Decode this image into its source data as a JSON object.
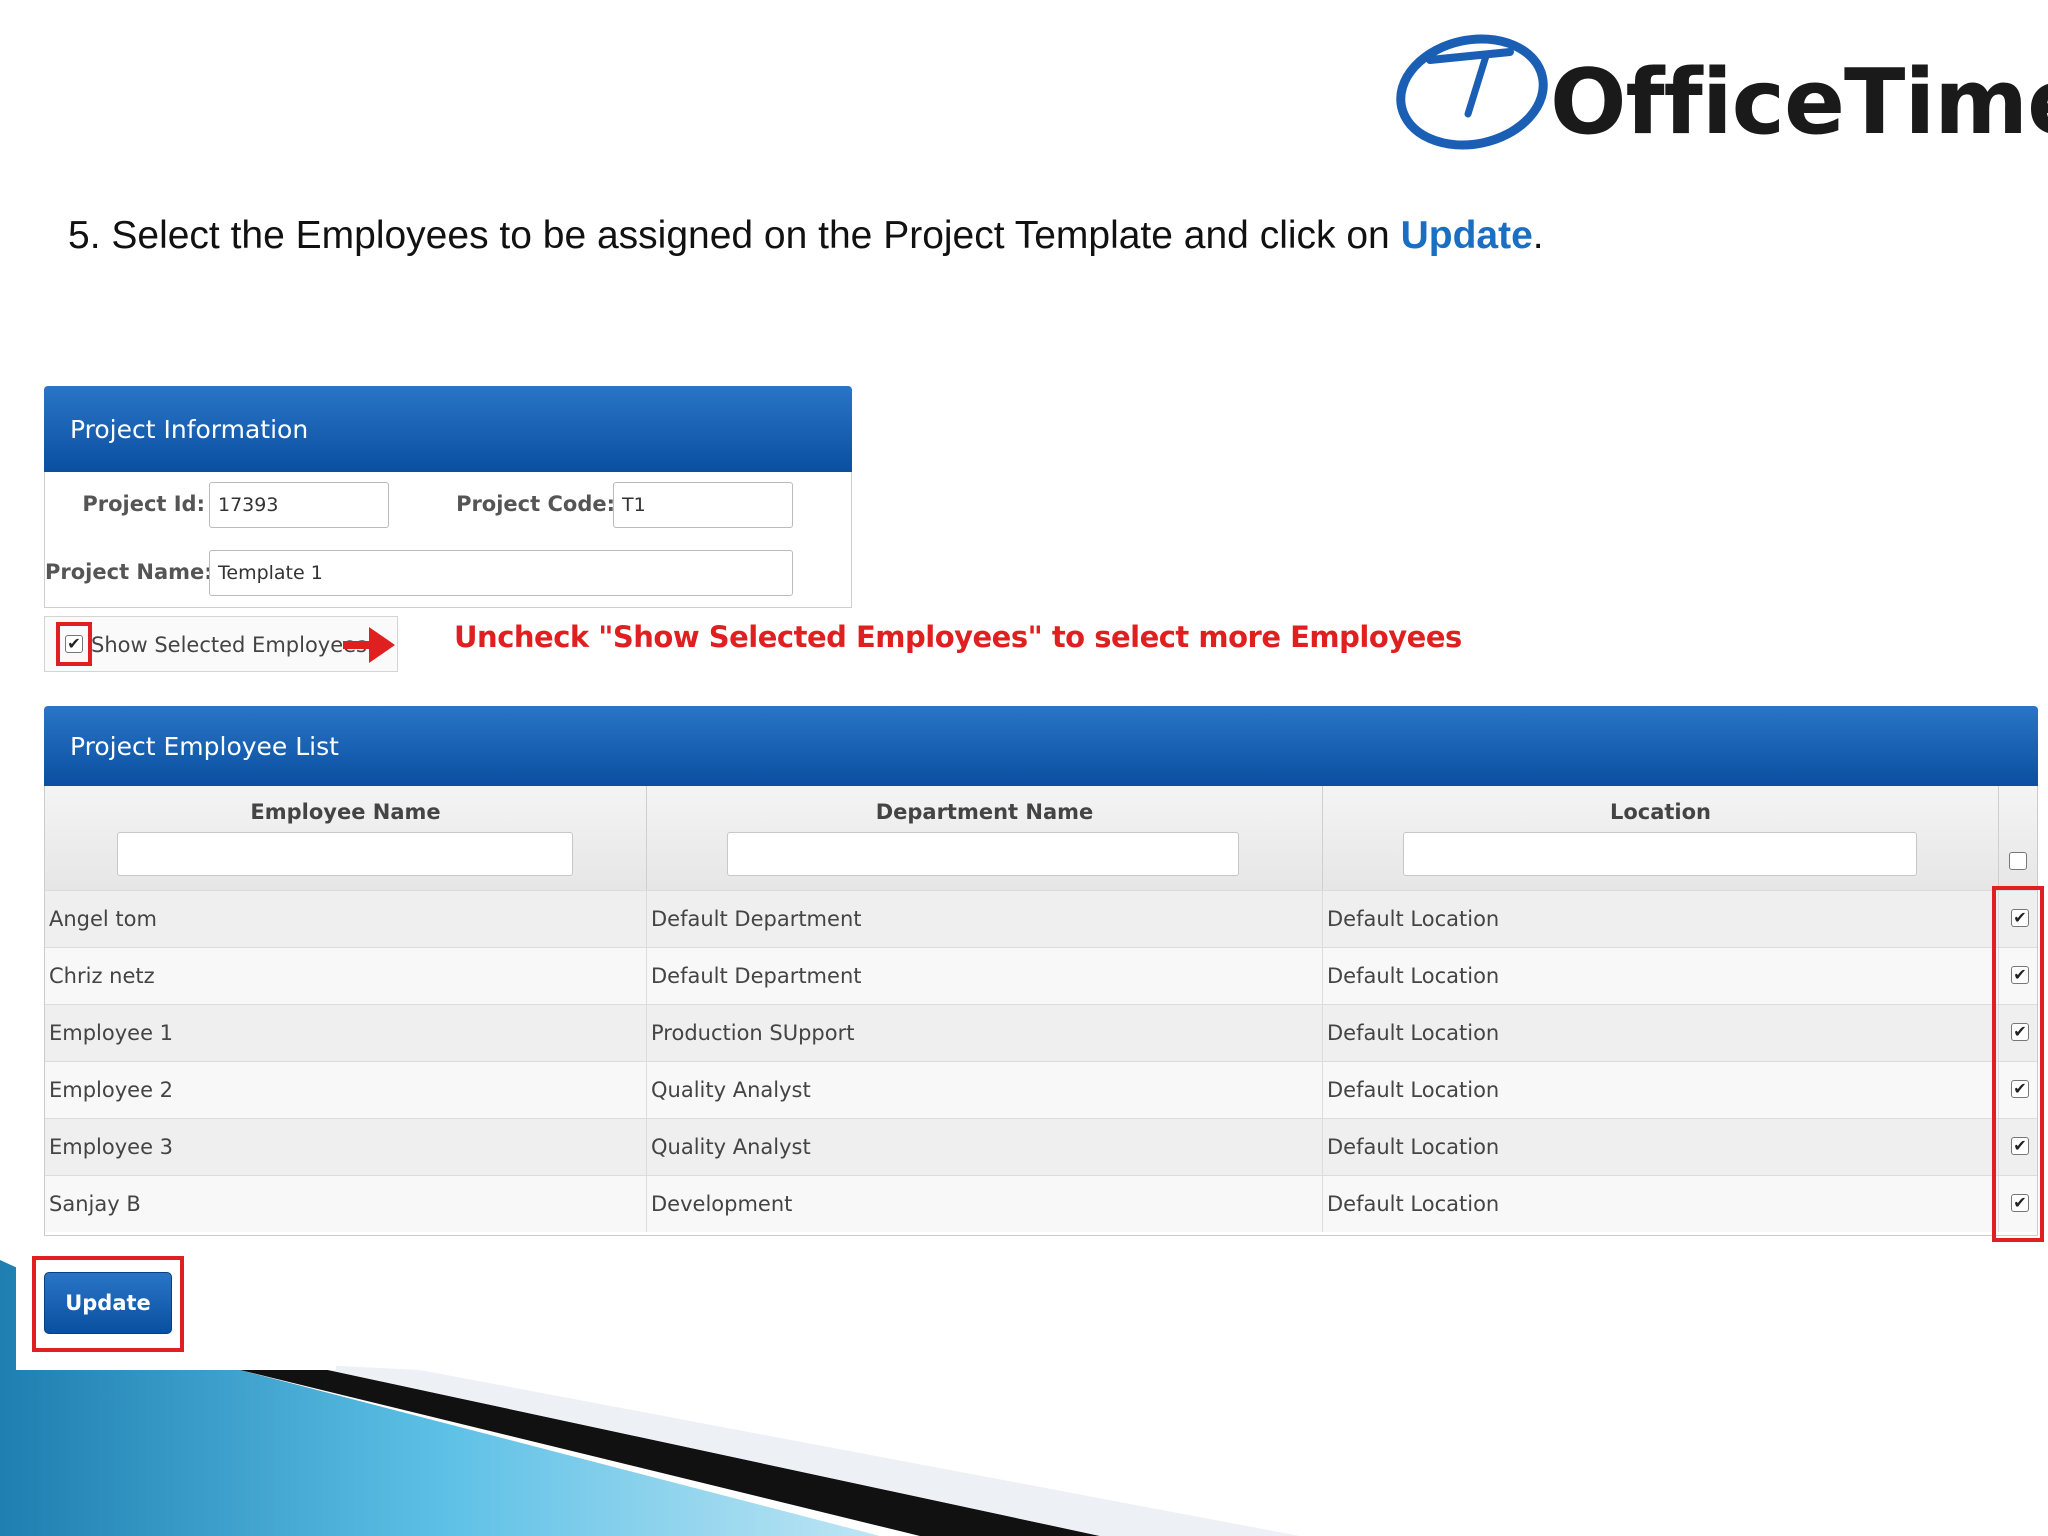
{
  "logo": {
    "brand_text": "OfficeTimer"
  },
  "instruction": {
    "prefix": "5. Select the Employees to be assigned on the Project Template and click on ",
    "highlight": "Update",
    "suffix": "."
  },
  "project_info": {
    "header": "Project Information",
    "project_id_label": "Project Id:",
    "project_id_value": "17393",
    "project_code_label": "Project Code:",
    "project_code_value": "T1",
    "project_name_label": "Project Name:",
    "project_name_value": "Template 1"
  },
  "show_selected": {
    "label": "Show Selected Employees",
    "checked": true
  },
  "annotation": "Uncheck \"Show Selected Employees\" to select more Employees",
  "employee_list": {
    "header": "Project Employee List",
    "columns": [
      "Employee Name",
      "Department Name",
      "Location"
    ],
    "rows": [
      {
        "name": "Angel tom",
        "department": "Default Department",
        "location": "Default Location",
        "selected": true
      },
      {
        "name": "Chriz netz",
        "department": "Default Department",
        "location": "Default Location",
        "selected": true
      },
      {
        "name": "Employee 1",
        "department": "Production SUpport",
        "location": "Default Location",
        "selected": true
      },
      {
        "name": "Employee 2",
        "department": "Quality Analyst",
        "location": "Default Location",
        "selected": true
      },
      {
        "name": "Employee 3",
        "department": "Quality Analyst",
        "location": "Default Location",
        "selected": true
      },
      {
        "name": "Sanjay B",
        "department": "Development",
        "location": "Default Location",
        "selected": true
      }
    ]
  },
  "update_button": {
    "label": "Update"
  },
  "colors": {
    "accent_blue": "#0a4fa0",
    "annotation_red": "#e02020",
    "highlight_blue": "#1a6fc2"
  }
}
